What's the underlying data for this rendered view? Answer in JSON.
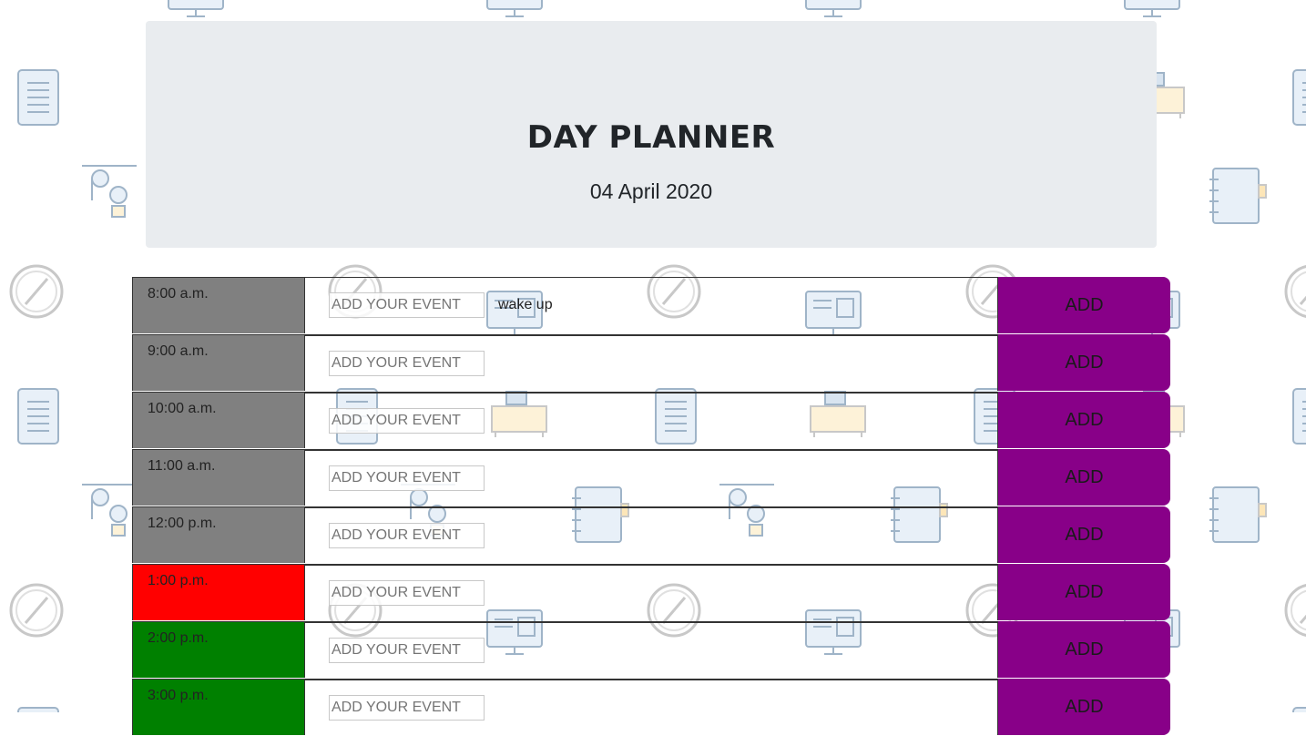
{
  "header": {
    "title": "DAY PLANNER",
    "date": "04 April 2020"
  },
  "colors": {
    "past": "#808080",
    "present": "#ff0000",
    "future": "#008000",
    "add_button": "#880088",
    "header_bg": "#e9ecef"
  },
  "planner": {
    "placeholder": "ADD YOUR EVENT",
    "add_label": "ADD",
    "rows": [
      {
        "time": "8:00 a.m.",
        "status": "past",
        "event": "wake up"
      },
      {
        "time": "9:00 a.m.",
        "status": "past",
        "event": ""
      },
      {
        "time": "10:00 a.m.",
        "status": "past",
        "event": ""
      },
      {
        "time": "11:00 a.m.",
        "status": "past",
        "event": ""
      },
      {
        "time": "12:00 p.m.",
        "status": "past",
        "event": ""
      },
      {
        "time": "1:00 p.m.",
        "status": "present",
        "event": ""
      },
      {
        "time": "2:00 p.m.",
        "status": "future",
        "event": ""
      },
      {
        "time": "3:00 p.m.",
        "status": "future",
        "event": ""
      }
    ]
  },
  "background_icons": [
    "monitor-icon",
    "tablet-icon",
    "pulley-icon",
    "clock-icon",
    "desk-icon",
    "notebook-icon"
  ]
}
